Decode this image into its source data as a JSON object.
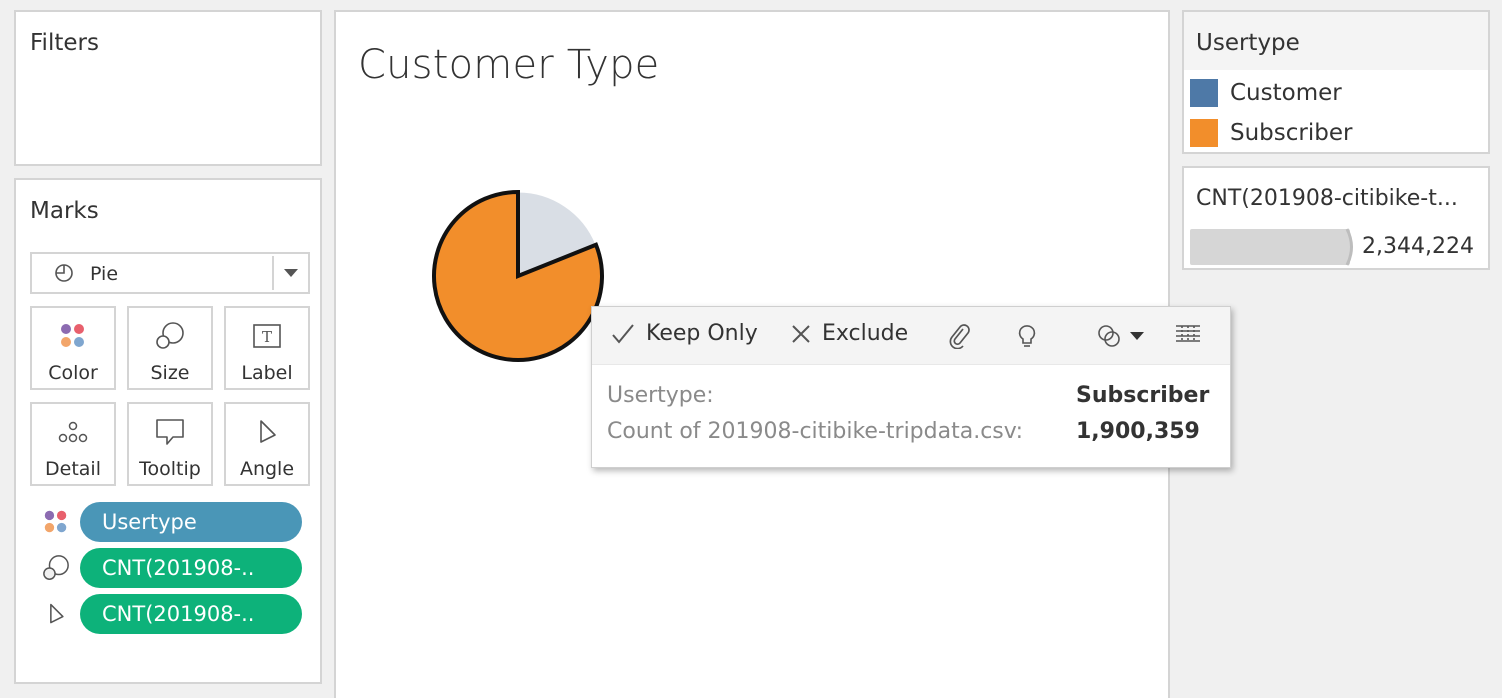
{
  "filters": {
    "title": "Filters"
  },
  "marks": {
    "title": "Marks",
    "mark_type": "Pie",
    "buttons": [
      {
        "label": "Color",
        "icon": "color-dots-icon"
      },
      {
        "label": "Size",
        "icon": "size-icon"
      },
      {
        "label": "Label",
        "icon": "label-icon"
      },
      {
        "label": "Detail",
        "icon": "detail-icon"
      },
      {
        "label": "Tooltip",
        "icon": "tooltip-icon"
      },
      {
        "label": "Angle",
        "icon": "angle-icon"
      }
    ],
    "pills": [
      {
        "label": "Usertype",
        "icon": "color-dots-icon",
        "color": "#4a96b7"
      },
      {
        "label": "CNT(201908-..",
        "icon": "size-icon",
        "color": "#0db27a"
      },
      {
        "label": "CNT(201908-..",
        "icon": "angle-icon",
        "color": "#0db27a"
      }
    ]
  },
  "view": {
    "title": "Customer Type"
  },
  "tooltip": {
    "keep_only": "Keep Only",
    "exclude": "Exclude",
    "rows": [
      {
        "key": "Usertype:",
        "value": "Subscriber"
      },
      {
        "key": "Count of 201908-citibike-tripdata.csv:",
        "value": "1,900,359"
      }
    ]
  },
  "legend": {
    "title": "Usertype",
    "items": [
      {
        "label": "Customer",
        "color": "#4e79a7"
      },
      {
        "label": "Subscriber",
        "color": "#f28e2b"
      }
    ]
  },
  "size_legend": {
    "title": "CNT(201908-citibike-t...",
    "value": "2,344,224"
  },
  "chart_data": {
    "type": "pie",
    "categories": [
      "Customer",
      "Subscriber"
    ],
    "values": [
      443865,
      1900359
    ],
    "colors": [
      "#4e79a7",
      "#f28e2b"
    ],
    "highlighted": "Subscriber"
  }
}
